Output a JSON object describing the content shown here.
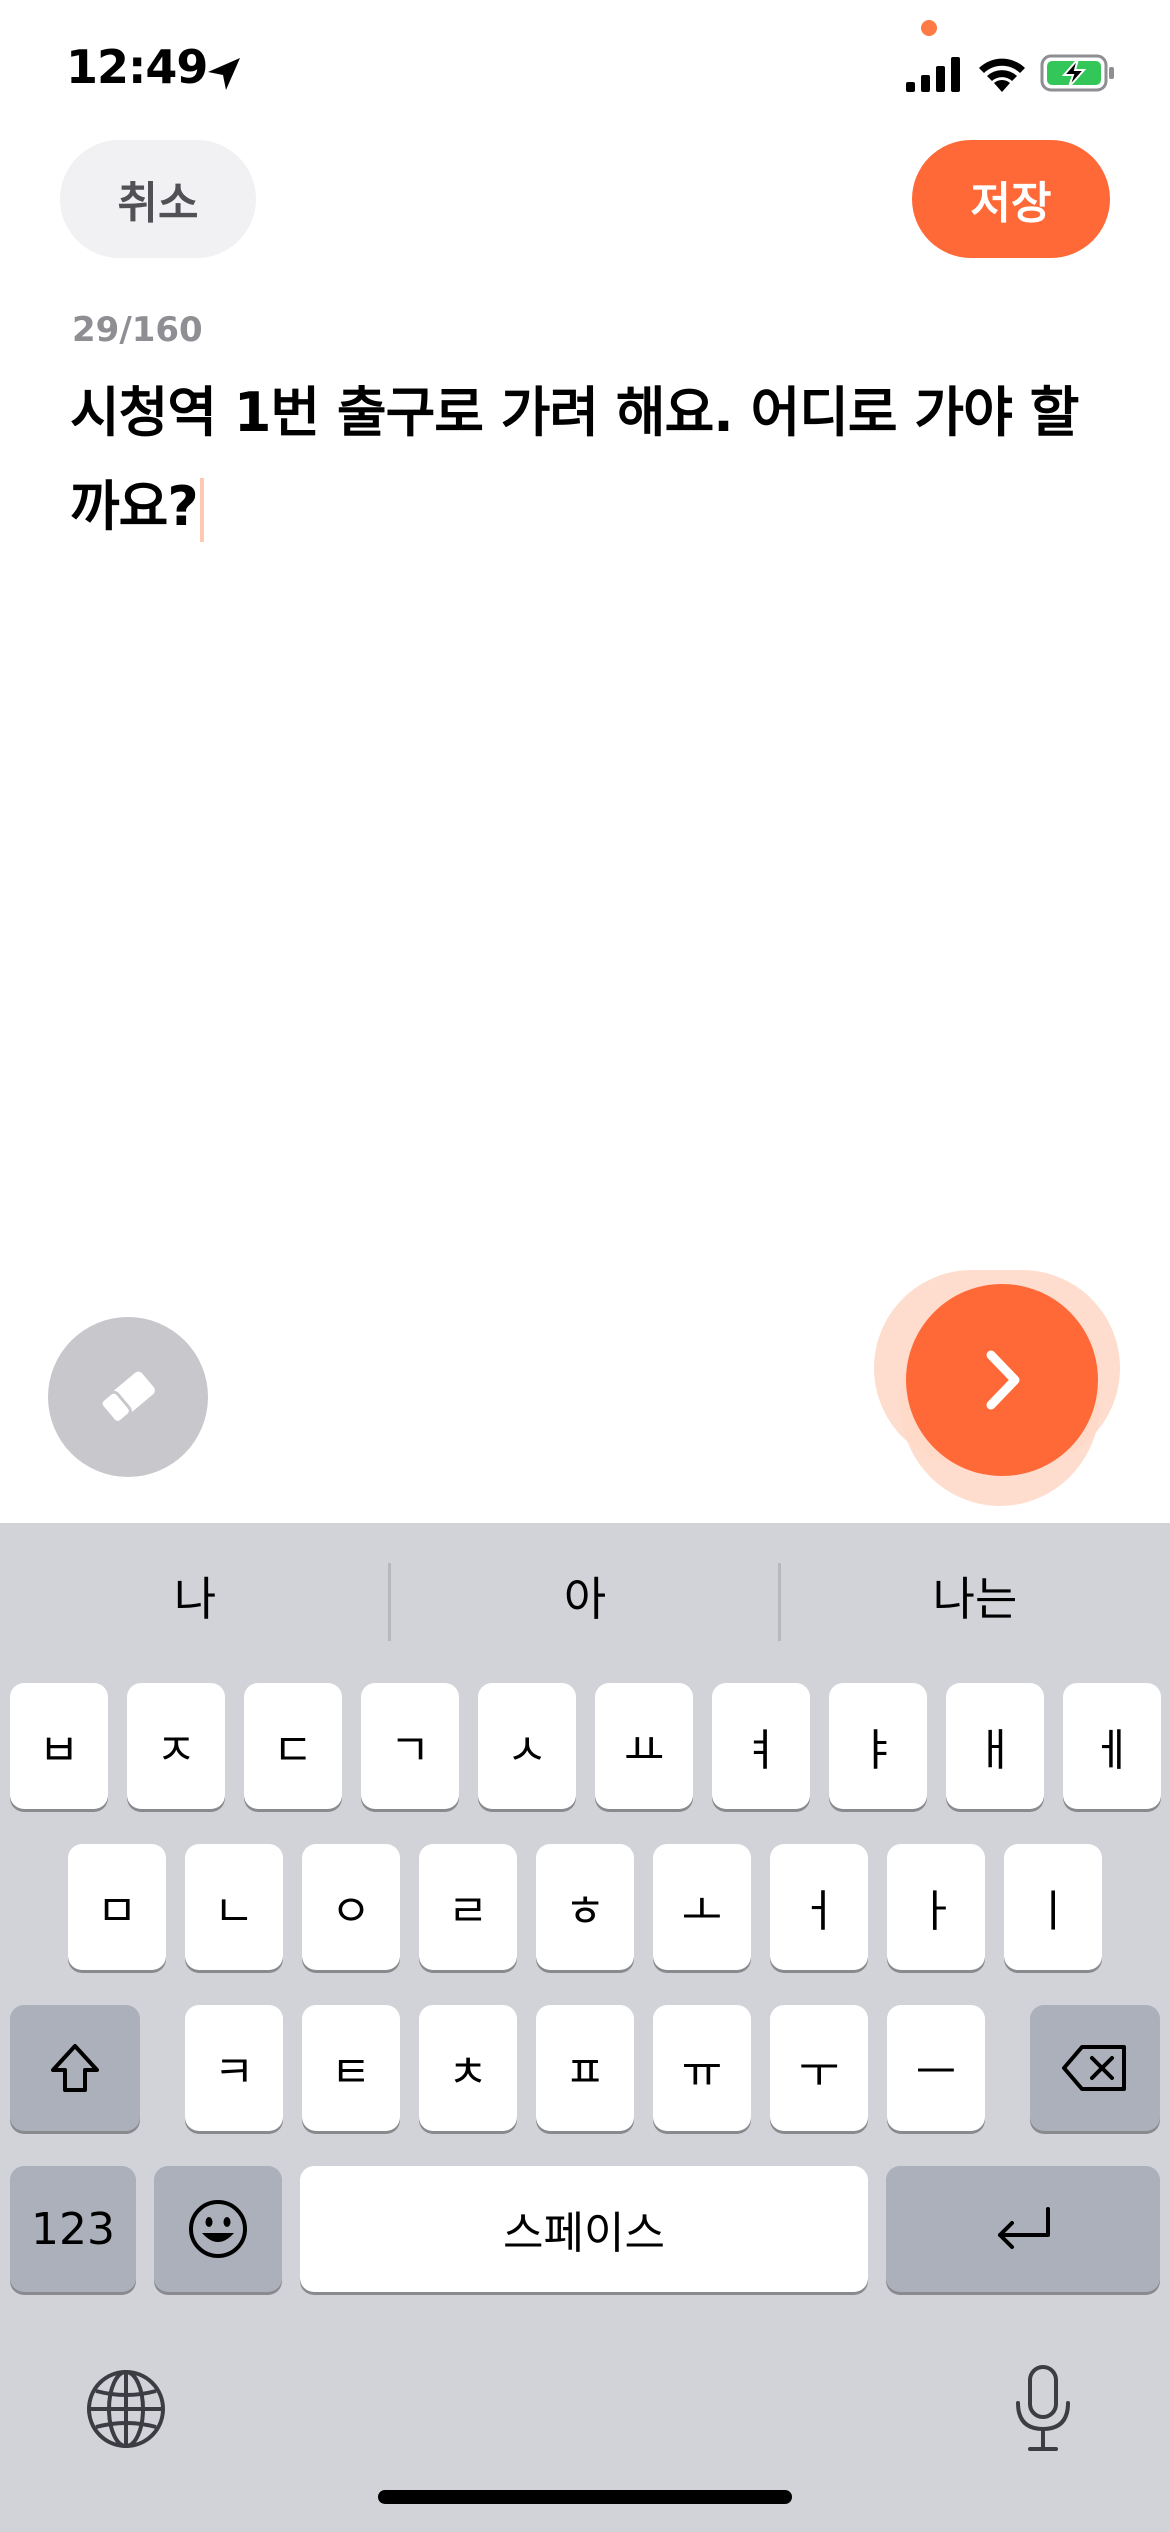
{
  "status_bar": {
    "time": "12:49"
  },
  "header": {
    "cancel_label": "취소",
    "save_label": "저장"
  },
  "editor": {
    "counter": "29/160",
    "text": "시청역 1번 출구로 가려 해요. 어디로 가야 할까요?"
  },
  "colors": {
    "accent": "#ff6937",
    "keyboard_bg": "#d1d3d9",
    "key_dark": "#abb0ba"
  },
  "icons": {
    "location": "location-arrow-icon",
    "eraser": "eraser-icon",
    "next": "chevron-right-icon",
    "shift": "shift-icon",
    "backspace": "backspace-icon",
    "emoji": "emoji-icon",
    "return": "return-icon",
    "globe": "globe-icon",
    "mic": "microphone-icon"
  },
  "keyboard": {
    "suggestions": [
      "나",
      "아",
      "나는"
    ],
    "row1": [
      "ㅂ",
      "ㅈ",
      "ㄷ",
      "ㄱ",
      "ㅅ",
      "ㅛ",
      "ㅕ",
      "ㅑ",
      "ㅐ",
      "ㅔ"
    ],
    "row2": [
      "ㅁ",
      "ㄴ",
      "ㅇ",
      "ㄹ",
      "ㅎ",
      "ㅗ",
      "ㅓ",
      "ㅏ",
      "ㅣ"
    ],
    "row3": [
      "ㅋ",
      "ㅌ",
      "ㅊ",
      "ㅍ",
      "ㅠ",
      "ㅜ",
      "ㅡ"
    ],
    "numbers_label": "123",
    "space_label": "스페이스"
  }
}
